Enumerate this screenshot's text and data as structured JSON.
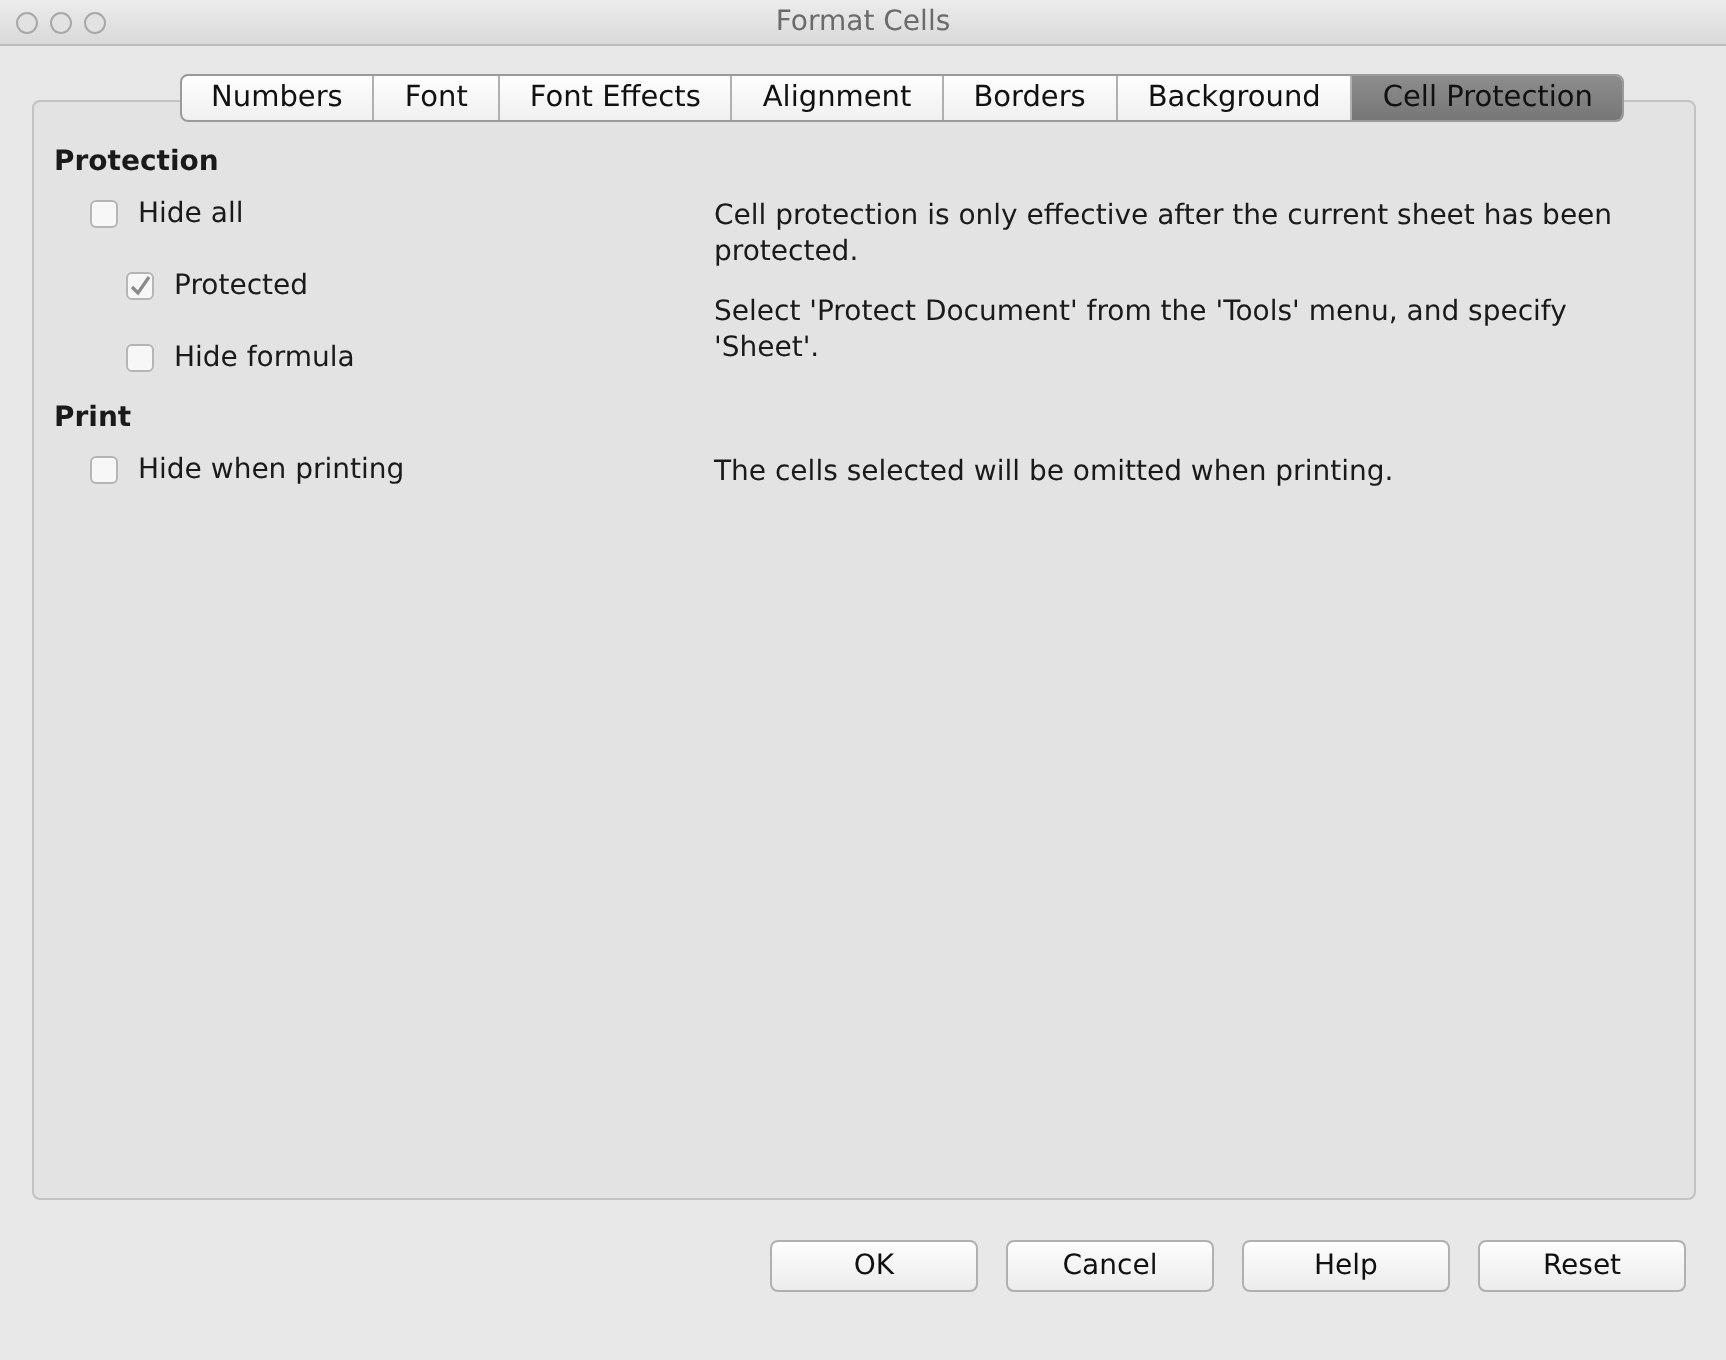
{
  "window": {
    "title": "Format Cells"
  },
  "tabs": [
    {
      "label": "Numbers",
      "selected": false
    },
    {
      "label": "Font",
      "selected": false
    },
    {
      "label": "Font Effects",
      "selected": false
    },
    {
      "label": "Alignment",
      "selected": false
    },
    {
      "label": "Borders",
      "selected": false
    },
    {
      "label": "Background",
      "selected": false
    },
    {
      "label": "Cell Protection",
      "selected": true
    }
  ],
  "sections": [
    {
      "heading": "Protection",
      "options": [
        {
          "label": "Hide all",
          "checked": false,
          "indented": false
        },
        {
          "label": "Protected",
          "checked": true,
          "indented": true
        },
        {
          "label": "Hide formula",
          "checked": false,
          "indented": true
        }
      ],
      "notes": [
        "Cell protection is only effective after the current sheet has been protected.",
        "Select 'Protect Document' from the 'Tools' menu, and specify 'Sheet'."
      ]
    },
    {
      "heading": "Print",
      "options": [
        {
          "label": "Hide when printing",
          "checked": false,
          "indented": false
        }
      ],
      "notes": [
        "The cells selected will be omitted when printing."
      ]
    }
  ],
  "buttons": [
    "OK",
    "Cancel",
    "Help",
    "Reset"
  ]
}
